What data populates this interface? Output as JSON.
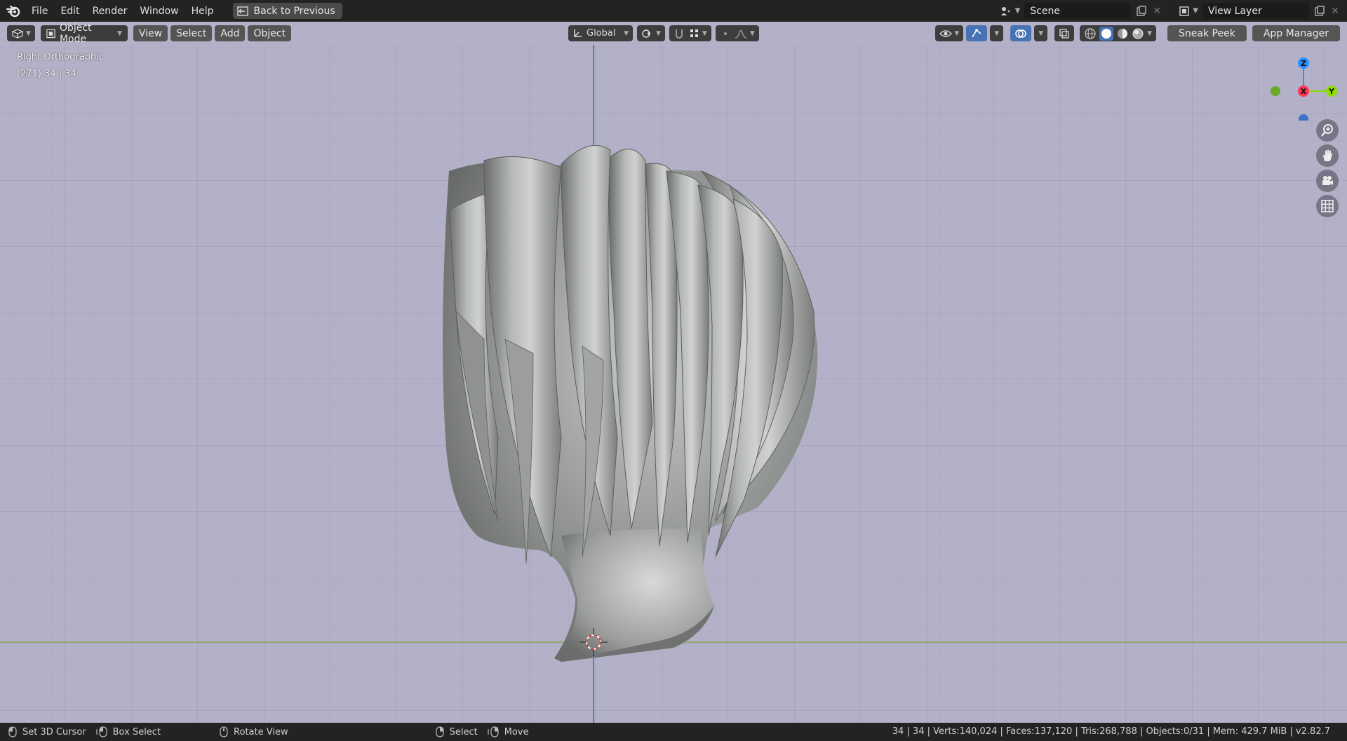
{
  "menu": [
    "File",
    "Edit",
    "Render",
    "Window",
    "Help"
  ],
  "back_button": "Back to Previous",
  "scene": {
    "name": "Scene"
  },
  "view_layer": {
    "name": "View Layer"
  },
  "header": {
    "mode": "Object Mode",
    "menus": [
      "View",
      "Select",
      "Add",
      "Object"
    ],
    "orientation": "Global",
    "sneak_peek": "Sneak Peek",
    "app_manager": "App Manager"
  },
  "viewport": {
    "view_name": "Right Orthographic",
    "collection_info": "(271) 34 | 34",
    "background_color": "#b3b1c7",
    "axis_colors": {
      "x": "#ff3352",
      "y": "#8bdc00",
      "z": "#2890ff"
    },
    "gizmo_labels": {
      "z": "Z",
      "x": "X",
      "y": "Y"
    }
  },
  "status": {
    "items": [
      "Set 3D Cursor",
      "Box Select",
      "Rotate View",
      "Select",
      "Move"
    ],
    "stats": "34 | 34 | Verts:140,024 | Faces:137,120 | Tris:268,788 | Objects:0/31 | Mem: 429.7 MiB | v2.82.7"
  },
  "icons": [
    "blender-logo-icon",
    "back-icon",
    "scene-icon",
    "view-layer-icon",
    "zoom-icon",
    "hand-icon",
    "camera-icon",
    "grid-icon"
  ]
}
